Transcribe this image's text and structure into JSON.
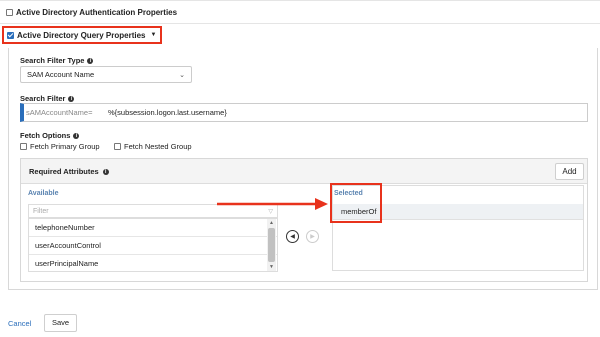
{
  "sections": {
    "auth_label": "Active Directory Authentication Properties",
    "query_label": "Active Directory Query Properties"
  },
  "search_filter_type": {
    "label": "Search Filter Type",
    "value": "SAM Account Name"
  },
  "search_filter": {
    "label": "Search Filter",
    "prefix": "sAMAccountName=",
    "value": "%{subsession.logon.last.username}"
  },
  "fetch_options": {
    "label": "Fetch Options",
    "primary_group": "Fetch Primary Group",
    "nested_group": "Fetch Nested Group"
  },
  "required_attributes": {
    "title": "Required Attributes",
    "add_label": "Add",
    "available_label": "Available",
    "filter_placeholder": "Filter",
    "available_items": [
      "telephoneNumber",
      "userAccountControl",
      "userPrincipalName"
    ],
    "selected_label": "Selected",
    "selected_items": [
      "memberOf"
    ]
  },
  "footer": {
    "cancel_label": "Cancel",
    "save_label": "Save"
  },
  "colors": {
    "highlight": "#e8321c",
    "accent": "#2a6ebb"
  }
}
